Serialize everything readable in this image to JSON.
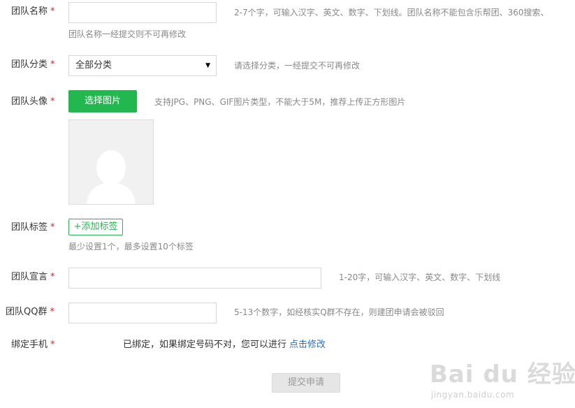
{
  "form": {
    "team_name": {
      "label": "团队名称",
      "required_mark": "*",
      "value": "",
      "hint": "2-7个字，可输入汉字、英文、数字、下划线。团队名称不能包含乐帮团、360搜索、",
      "note": "团队名称一经提交则不可再修改"
    },
    "team_category": {
      "label": "团队分类",
      "required_mark": "*",
      "selected": "全部分类",
      "hint": "请选择分类，一经提交不可再修改"
    },
    "team_avatar": {
      "label": "团队头像",
      "required_mark": "*",
      "button": "选择图片",
      "hint": "支持JPG、PNG、GIF图片类型，不能大于5M，推荐上传正方形图片"
    },
    "team_tags": {
      "label": "团队标签",
      "required_mark": "*",
      "button": "+添加标签",
      "note": "最少设置1个，最多设置10个标签"
    },
    "team_slogan": {
      "label": "团队宣言",
      "required_mark": "*",
      "value": "",
      "hint": "1-20字，可输入汉字、英文、数字、下划线"
    },
    "team_qq": {
      "label": "团队QQ群",
      "required_mark": "*",
      "value": "",
      "hint": "5-13个数字，如经核实Q群不存在，则建团申请会被驳回"
    },
    "bind_phone": {
      "label": "绑定手机",
      "required_mark": "*",
      "text": "已绑定，如果绑定号码不对，您可以进行",
      "link": "点击修改"
    },
    "submit_label": "提交申请"
  },
  "watermark": {
    "main": "Bai du 经验",
    "sub": "jingyan.baidu.com"
  },
  "colors": {
    "accent_green": "#23b84f",
    "required_red": "#e02020",
    "link_blue": "#2a6fc9",
    "hint_gray": "#888888"
  }
}
